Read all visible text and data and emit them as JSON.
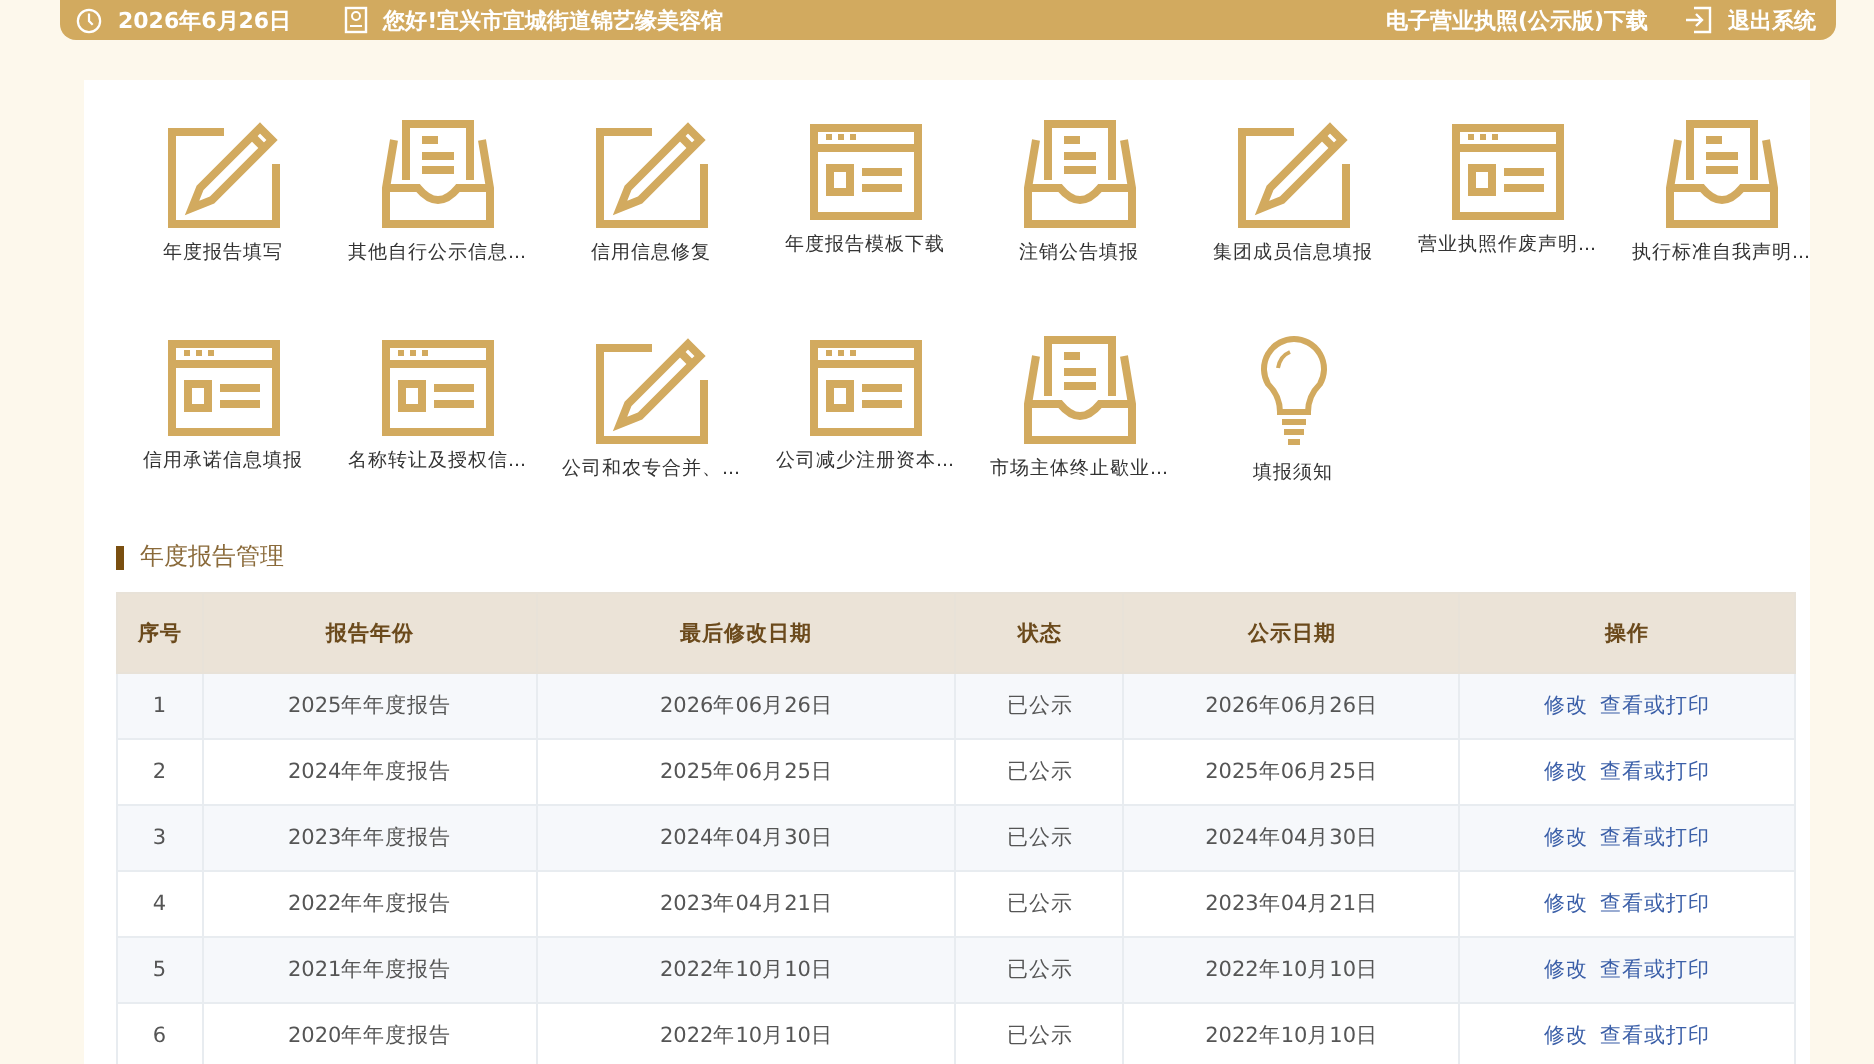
{
  "header": {
    "date": "2026年6月26日",
    "greeting": "您好!宜兴市宜城街道锦艺缘美容馆",
    "license_link": "电子营业执照(公示版)下载",
    "logout": "退出系统"
  },
  "shortcuts": [
    {
      "kind": "pencil",
      "label": "年度报告填写"
    },
    {
      "kind": "tray",
      "label": "其他自行公示信息..."
    },
    {
      "kind": "pencil",
      "label": "信用信息修复"
    },
    {
      "kind": "window",
      "label": "年度报告模板下载"
    },
    {
      "kind": "tray",
      "label": "注销公告填报"
    },
    {
      "kind": "pencil",
      "label": "集团成员信息填报"
    },
    {
      "kind": "window",
      "label": "营业执照作废声明..."
    },
    {
      "kind": "tray",
      "label": "执行标准自我声明..."
    },
    {
      "kind": "window",
      "label": "信用承诺信息填报"
    },
    {
      "kind": "window",
      "label": "名称转让及授权信..."
    },
    {
      "kind": "pencil",
      "label": "公司和农专合并、..."
    },
    {
      "kind": "window",
      "label": "公司减少注册资本..."
    },
    {
      "kind": "tray",
      "label": "市场主体终止歇业..."
    },
    {
      "kind": "bulb",
      "label": "填报须知"
    }
  ],
  "section_title": "年度报告管理",
  "table": {
    "columns": [
      "序号",
      "报告年份",
      "最后修改日期",
      "状态",
      "公示日期",
      "操作"
    ],
    "rows": [
      {
        "cells": [
          "1",
          "2025年年度报告",
          "2026年06月26日",
          "已公示",
          "2026年06月26日"
        ],
        "actions": [
          "修改",
          "查看或打印"
        ]
      },
      {
        "cells": [
          "2",
          "2024年年度报告",
          "2025年06月25日",
          "已公示",
          "2025年06月25日"
        ],
        "actions": [
          "修改",
          "查看或打印"
        ]
      },
      {
        "cells": [
          "3",
          "2023年年度报告",
          "2024年04月30日",
          "已公示",
          "2024年04月30日"
        ],
        "actions": [
          "修改",
          "查看或打印"
        ]
      },
      {
        "cells": [
          "4",
          "2022年年度报告",
          "2023年04月21日",
          "已公示",
          "2023年04月21日"
        ],
        "actions": [
          "修改",
          "查看或打印"
        ]
      },
      {
        "cells": [
          "5",
          "2021年年度报告",
          "2022年10月10日",
          "已公示",
          "2022年10月10日"
        ],
        "actions": [
          "修改",
          "查看或打印"
        ]
      },
      {
        "cells": [
          "6",
          "2020年年度报告",
          "2022年10月10日",
          "已公示",
          "2022年10月10日"
        ],
        "actions": [
          "修改",
          "查看或打印"
        ]
      }
    ]
  }
}
